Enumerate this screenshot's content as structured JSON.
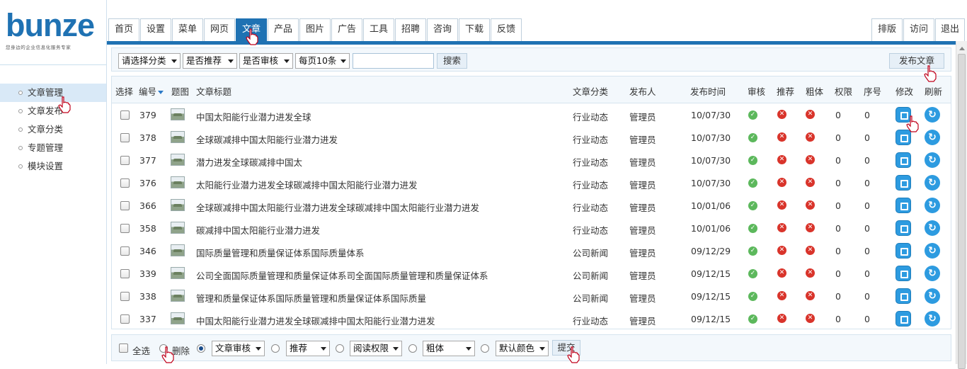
{
  "brand": {
    "name": "bunze",
    "tagline": "您身边的企业信息化服务专家"
  },
  "sidebar": {
    "items": [
      {
        "label": "文章管理",
        "active": true
      },
      {
        "label": "文章发布",
        "active": false
      },
      {
        "label": "文章分类",
        "active": false
      },
      {
        "label": "专题管理",
        "active": false
      },
      {
        "label": "模块设置",
        "active": false
      }
    ]
  },
  "nav": {
    "tabs": [
      {
        "label": "首页"
      },
      {
        "label": "设置"
      },
      {
        "label": "菜单"
      },
      {
        "label": "网页"
      },
      {
        "label": "文章",
        "active": true
      },
      {
        "label": "产品"
      },
      {
        "label": "图片"
      },
      {
        "label": "广告"
      },
      {
        "label": "工具"
      },
      {
        "label": "招聘"
      },
      {
        "label": "咨询"
      },
      {
        "label": "下载"
      },
      {
        "label": "反馈"
      }
    ],
    "right": [
      {
        "label": "排版"
      },
      {
        "label": "访问"
      },
      {
        "label": "退出"
      }
    ]
  },
  "filters": {
    "category": "请选择分类",
    "recommend": "是否推荐",
    "review": "是否审核",
    "per_page": "每页10条",
    "search_value": "",
    "search_button": "搜索",
    "publish_button": "发布文章"
  },
  "table": {
    "headers": {
      "select": "选择",
      "id": "编号",
      "image": "题图",
      "title": "文章标题",
      "category": "文章分类",
      "author": "发布人",
      "date": "发布时间",
      "review": "审核",
      "recommend": "推荐",
      "bold": "粗体",
      "permission": "权限",
      "order": "序号",
      "edit": "修改",
      "refresh": "刷新"
    },
    "rows": [
      {
        "id": "379",
        "title": "中国太阳能行业潜力进发全球",
        "category": "行业动态",
        "author": "管理员",
        "date": "10/07/30",
        "permission": "0",
        "order": "0"
      },
      {
        "id": "378",
        "title": "全球碳减排中国太阳能行业潜力进发",
        "category": "行业动态",
        "author": "管理员",
        "date": "10/07/30",
        "permission": "0",
        "order": "0"
      },
      {
        "id": "377",
        "title": "潜力进发全球碳减排中国太",
        "category": "行业动态",
        "author": "管理员",
        "date": "10/07/30",
        "permission": "0",
        "order": "0"
      },
      {
        "id": "376",
        "title": "太阳能行业潜力进发全球碳减排中国太阳能行业潜力进发",
        "category": "行业动态",
        "author": "管理员",
        "date": "10/07/30",
        "permission": "0",
        "order": "0"
      },
      {
        "id": "366",
        "title": "全球碳减排中国太阳能行业潜力进发全球碳减排中国太阳能行业潜力进发",
        "category": "行业动态",
        "author": "管理员",
        "date": "10/01/06",
        "permission": "0",
        "order": "0"
      },
      {
        "id": "358",
        "title": "碳减排中国太阳能行业潜力进发",
        "category": "行业动态",
        "author": "管理员",
        "date": "10/01/06",
        "permission": "0",
        "order": "0"
      },
      {
        "id": "346",
        "title": "国际质量管理和质量保证体系国际质量体系",
        "category": "公司新闻",
        "author": "管理员",
        "date": "09/12/29",
        "permission": "0",
        "order": "0"
      },
      {
        "id": "339",
        "title": "公司全面国际质量管理和质量保证体系司全面国际质量管理和质量保证体系",
        "category": "公司新闻",
        "author": "管理员",
        "date": "09/12/15",
        "permission": "0",
        "order": "0"
      },
      {
        "id": "338",
        "title": "管理和质量保证体系国际质量管理和质量保证体系国际质量",
        "category": "公司新闻",
        "author": "管理员",
        "date": "09/12/15",
        "permission": "0",
        "order": "0"
      },
      {
        "id": "337",
        "title": "中国太阳能行业潜力进发全球碳减排中国太阳能行业潜力进发",
        "category": "行业动态",
        "author": "管理员",
        "date": "09/12/15",
        "permission": "0",
        "order": "0"
      }
    ]
  },
  "bottom": {
    "select_all": "全选",
    "delete": "删除",
    "review_select": "文章审核",
    "recommend_select": "推荐",
    "permission_select": "阅读权限",
    "bold_select": "粗体",
    "color_select": "默认颜色",
    "submit": "提交"
  },
  "colors": {
    "accent": "#1f72b3",
    "ok": "#5cb85c",
    "no": "#d9342b",
    "icon": "#2d9be0"
  }
}
